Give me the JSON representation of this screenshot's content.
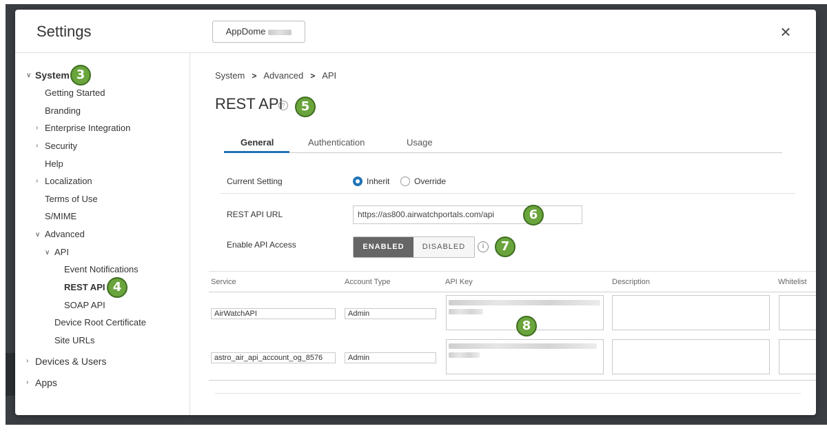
{
  "modal": {
    "title": "Settings",
    "org_button_label": "AppDome",
    "close_label": "×"
  },
  "sidebar": {
    "system": "System",
    "items": {
      "getting_started": "Getting Started",
      "branding": "Branding",
      "enterprise_integration": "Enterprise Integration",
      "security": "Security",
      "help": "Help",
      "localization": "Localization",
      "terms_of_use": "Terms of Use",
      "smime": "S/MIME",
      "advanced": "Advanced",
      "api": "API",
      "event_notifications": "Event Notifications",
      "rest_api": "REST API",
      "soap_api": "SOAP API",
      "device_root_certificate": "Device Root Certificate",
      "site_urls": "Site URLs"
    },
    "devices_users": "Devices & Users",
    "apps": "Apps"
  },
  "badges": {
    "b3": "3",
    "b4": "4",
    "b5": "5",
    "b6": "6",
    "b7": "7",
    "b8": "8"
  },
  "breadcrumb": [
    "System",
    "Advanced",
    "API"
  ],
  "page": {
    "title": "REST API",
    "help_glyph": "?"
  },
  "tabs": [
    {
      "label": "General",
      "active": true
    },
    {
      "label": "Authentication",
      "active": false
    },
    {
      "label": "Usage",
      "active": false
    }
  ],
  "form": {
    "current_setting_label": "Current Setting",
    "inherit_label": "Inherit",
    "override_label": "Override",
    "selected": "Inherit",
    "rest_api_url_label": "REST API URL",
    "rest_api_url_value": "https://as800.airwatchportals.com/api",
    "enable_api_access_label": "Enable API Access",
    "enabled_label": "ENABLED",
    "disabled_label": "DISABLED",
    "info_glyph": "i"
  },
  "table": {
    "headers": [
      "Service",
      "Account Type",
      "API Key",
      "Description",
      "Whitelist"
    ],
    "rows": [
      {
        "service": "AirWatchAPI",
        "account_type": "Admin"
      },
      {
        "service": "astro_air_api_account_og_8576",
        "account_type": "Admin"
      }
    ]
  },
  "colors": {
    "accent": "#1f73b7",
    "badge": "#6aa43c",
    "toggle_on": "#666666"
  }
}
